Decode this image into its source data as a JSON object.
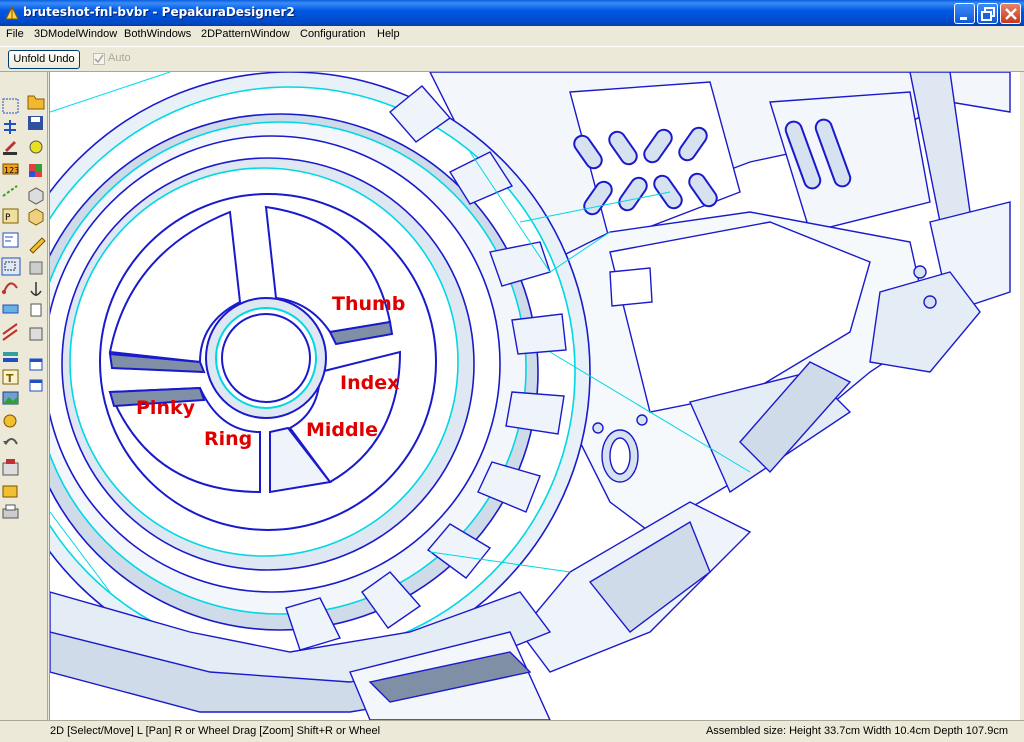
{
  "window": {
    "title": "bruteshot-fnl-bvbr - PepakuraDesigner2",
    "minimize_icon": "minimize-icon",
    "maximize_icon": "restore-icon",
    "close_icon": "close-icon"
  },
  "menu": {
    "items": [
      "File",
      "3DModelWindow",
      "BothWindows",
      "2DPatternWindow",
      "Configuration",
      "Help"
    ]
  },
  "toolbar": {
    "unfold_undo_label": "Unfold Undo",
    "auto_label": "Auto",
    "auto_checked": true,
    "auto_enabled": false
  },
  "sidebar": {
    "tools": [
      "select-icon",
      "open-folder-icon",
      "move-icon",
      "save-icon",
      "paint-icon",
      "brush-icon",
      "number-icon",
      "cube-color-icon",
      "edge-icon",
      "box-icon",
      "pattern-icon",
      "box-open-icon",
      "flap-icon",
      "pencil-icon",
      "select-zoom-icon",
      "parts-icon",
      "curve-icon",
      "anchor-icon",
      "ruler-icon",
      "rectangle-icon",
      "join-icon",
      "zoom-fit-icon",
      "layer-icon",
      "window-icon",
      "text-icon",
      "window2-icon",
      "image-icon",
      "paint2-icon",
      "undo-icon",
      "print-icon",
      "copy-icon",
      "printer-icon"
    ]
  },
  "viewport": {
    "labels": {
      "thumb": "Thumb",
      "index": "Index",
      "middle": "Middle",
      "ring": "Ring",
      "pinky": "Pinky"
    },
    "label_color": "#e00000"
  },
  "status": {
    "left": "2D [Select/Move] L [Pan] R or Wheel Drag [Zoom] Shift+R or Wheel",
    "right": "Assembled size: Height 33.7cm Width 10.4cm Depth 107.9cm"
  },
  "colors": {
    "titlebar": "#0054e3",
    "chrome": "#ece9d8",
    "model_edge_blue": "#1a1acc",
    "model_edge_cyan": "#00e0e8",
    "model_fill": "#dfeaf5",
    "model_shadow": "#6f7f95"
  }
}
